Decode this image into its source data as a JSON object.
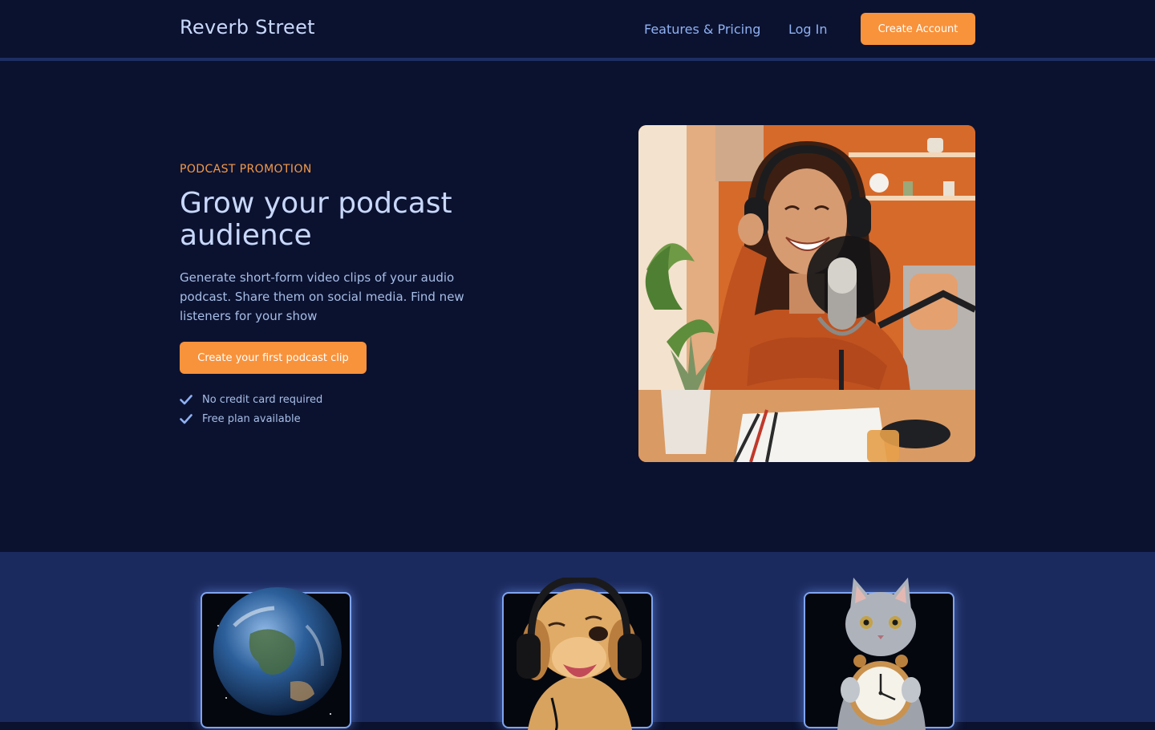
{
  "brand": {
    "name": "Reverb Street"
  },
  "nav": {
    "features": "Features & Pricing",
    "login": "Log In",
    "create_account": "Create Account"
  },
  "hero": {
    "eyebrow": "PODCAST PROMOTION",
    "title": "Grow your podcast audience",
    "description": "Generate short-form video clips of your audio podcast. Share them on social media. Find new listeners for your show",
    "cta": "Create your first podcast clip",
    "checks": [
      "No credit card required",
      "Free plan available"
    ]
  },
  "colors": {
    "background": "#0b1230",
    "band": "#1b2a5e",
    "accent": "#f8923b",
    "text_primary": "#c9d8fa",
    "text_secondary": "#a7bde6",
    "link": "#8fb1f2"
  },
  "icons": {
    "check": "check-icon"
  }
}
